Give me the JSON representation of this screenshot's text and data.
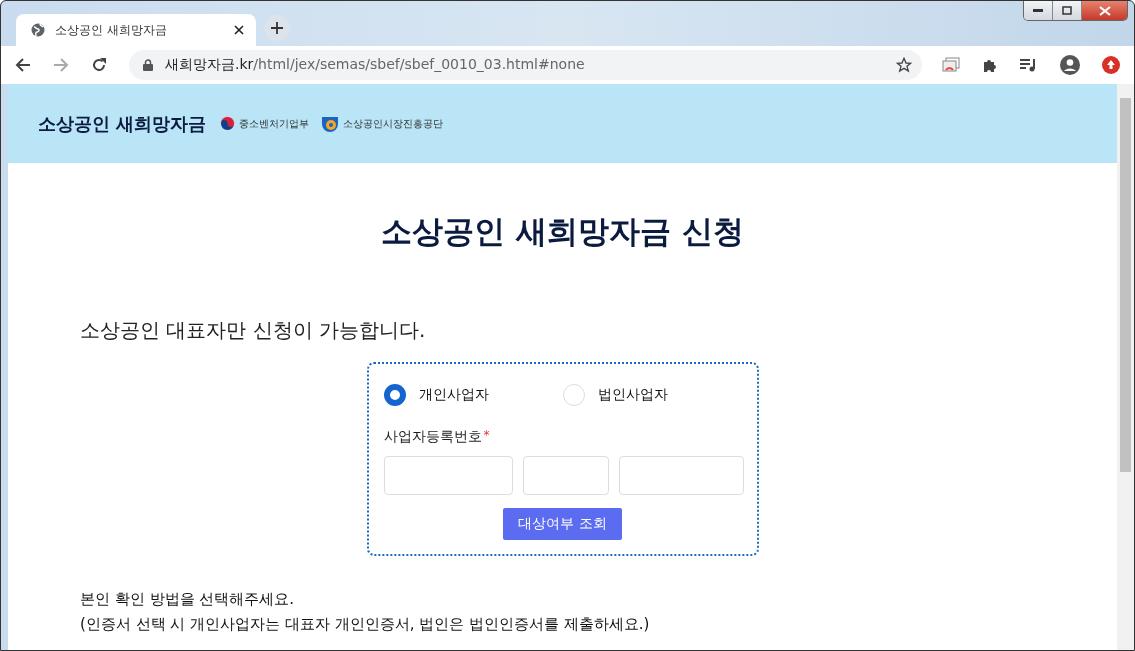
{
  "browser": {
    "tab_title": "소상공인 새희망자금",
    "url_host": "새희망자금.kr",
    "url_path": "/html/jex/semas/sbef/sbef_0010_03.html#none"
  },
  "header": {
    "site_title": "소상공인 새희망자금",
    "logos": [
      {
        "kind": "ministry",
        "label": "중소벤처기업부"
      },
      {
        "kind": "agency",
        "label": "소상공인시장진흥공단"
      }
    ]
  },
  "page_title": "소상공인 새희망자금 신청",
  "notice": "소상공인 대표자만 신청이 가능합니다.",
  "form": {
    "business_types": [
      {
        "label": "개인사업자",
        "selected": true
      },
      {
        "label": "법인사업자",
        "selected": false
      }
    ],
    "field_label": "사업자등록번호",
    "required_mark": "*",
    "button": "대상여부 조회"
  },
  "instructions": [
    "본인 확인 방법을 선택해주세요.",
    "(인증서 선택 시 개인사업자는 대표자 개인인증서, 법인은 법인인증서를 제출하세요.)"
  ]
}
